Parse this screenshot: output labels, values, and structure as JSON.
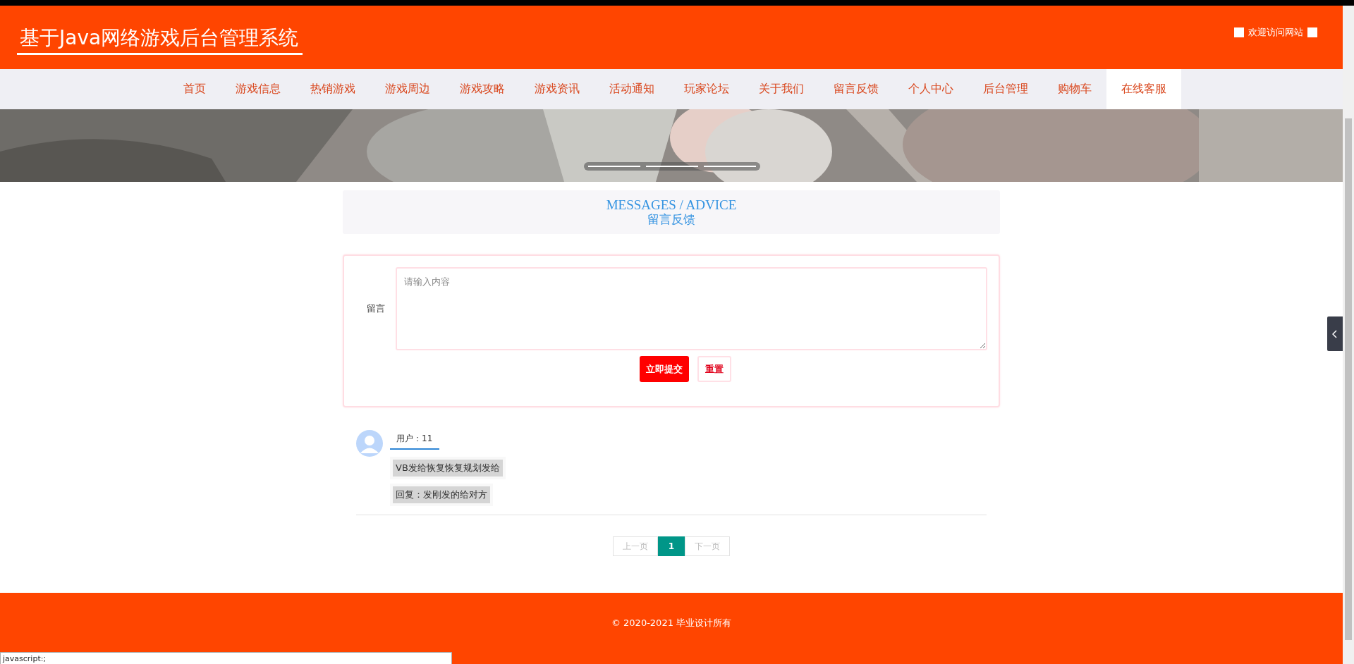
{
  "header": {
    "title": "基于Java网络游戏后台管理系统",
    "welcome": "欢迎访问网站"
  },
  "nav": [
    {
      "label": "首页",
      "highlighted": false
    },
    {
      "label": "游戏信息",
      "highlighted": false
    },
    {
      "label": "热销游戏",
      "highlighted": false
    },
    {
      "label": "游戏周边",
      "highlighted": false
    },
    {
      "label": "游戏攻略",
      "highlighted": false
    },
    {
      "label": "游戏资讯",
      "highlighted": false
    },
    {
      "label": "活动通知",
      "highlighted": false
    },
    {
      "label": "玩家论坛",
      "highlighted": false
    },
    {
      "label": "关于我们",
      "highlighted": false
    },
    {
      "label": "留言反馈",
      "highlighted": false
    },
    {
      "label": "个人中心",
      "highlighted": false
    },
    {
      "label": "后台管理",
      "highlighted": false
    },
    {
      "label": "购物车",
      "highlighted": false
    },
    {
      "label": "在线客服",
      "highlighted": true
    }
  ],
  "section_title": {
    "english": "MESSAGES / ADVICE",
    "chinese": "留言反馈"
  },
  "form": {
    "label": "留言",
    "placeholder": "请输入内容",
    "submit": "立即提交",
    "reset": "重置"
  },
  "messages": [
    {
      "user": "用户：11",
      "content": "VB发给恢复恢复规划发给",
      "reply": "回复：发刚发的给对方"
    }
  ],
  "pagination": {
    "prev": "上一页",
    "pages": [
      {
        "label": "1",
        "selected": true
      }
    ],
    "next": "下一页"
  },
  "footer": {
    "text": "© 2020-2021 毕业设计所有"
  },
  "status_tip": "javascript:;"
}
